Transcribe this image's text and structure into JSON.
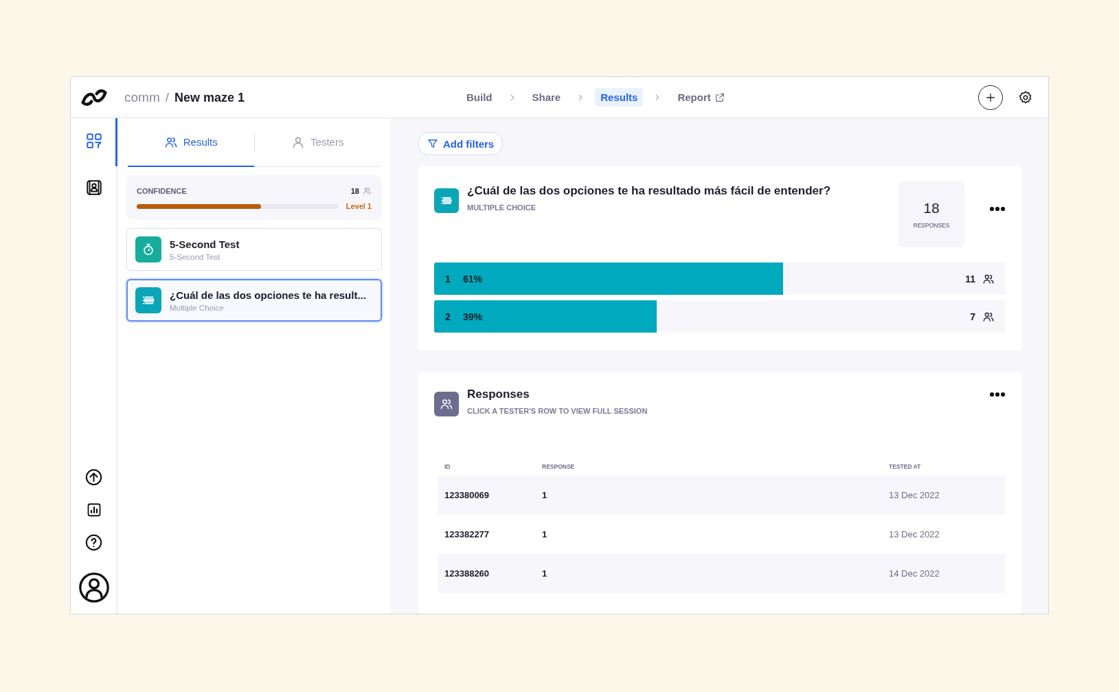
{
  "breadcrumb": {
    "workspace": "comm",
    "separator": "/",
    "project": "New maze 1"
  },
  "steps": [
    {
      "label": "Build",
      "selected": false,
      "external": false
    },
    {
      "label": "Share",
      "selected": false,
      "external": false
    },
    {
      "label": "Results",
      "selected": true,
      "external": false
    },
    {
      "label": "Report",
      "selected": false,
      "external": true
    }
  ],
  "tabs": [
    {
      "label": "Results",
      "kind": "group",
      "selected": true
    },
    {
      "label": "Testers",
      "kind": "person",
      "selected": false
    }
  ],
  "confidence": {
    "label": "CONFIDENCE",
    "count": "18",
    "level": 0.62,
    "level_label": "Level 1"
  },
  "blocks": [
    {
      "kind": "timer",
      "title": "5-Second Test",
      "subtitle": "5-Second Test",
      "selected": false
    },
    {
      "kind": "list",
      "title": "¿Cuál de las dos opciones te ha result...",
      "subtitle": "Multiple Choice",
      "selected": true
    }
  ],
  "filters_button": "Add filters",
  "question": {
    "title": "¿Cuál de las dos opciones te ha resultado más fácil de entender?",
    "type": "MULTIPLE CHOICE",
    "responses_count": "18",
    "responses_label": "RESPONSES",
    "options": [
      {
        "label": "1",
        "percent": "61%",
        "count": "11",
        "level": 0.61
      },
      {
        "label": "2",
        "percent": "39%",
        "count": "7",
        "level": 0.39
      }
    ]
  },
  "responses": {
    "title": "Responses",
    "subtitle": "CLICK A TESTER'S ROW TO VIEW FULL SESSION",
    "columns": [
      "ID",
      "RESPONSE",
      "TESTED AT"
    ],
    "rows": [
      [
        "123380069",
        "1",
        "13 Dec 2022"
      ],
      [
        "123382277",
        "1",
        "13 Dec 2022"
      ],
      [
        "123388260",
        "1",
        "14 Dec 2022"
      ]
    ]
  }
}
